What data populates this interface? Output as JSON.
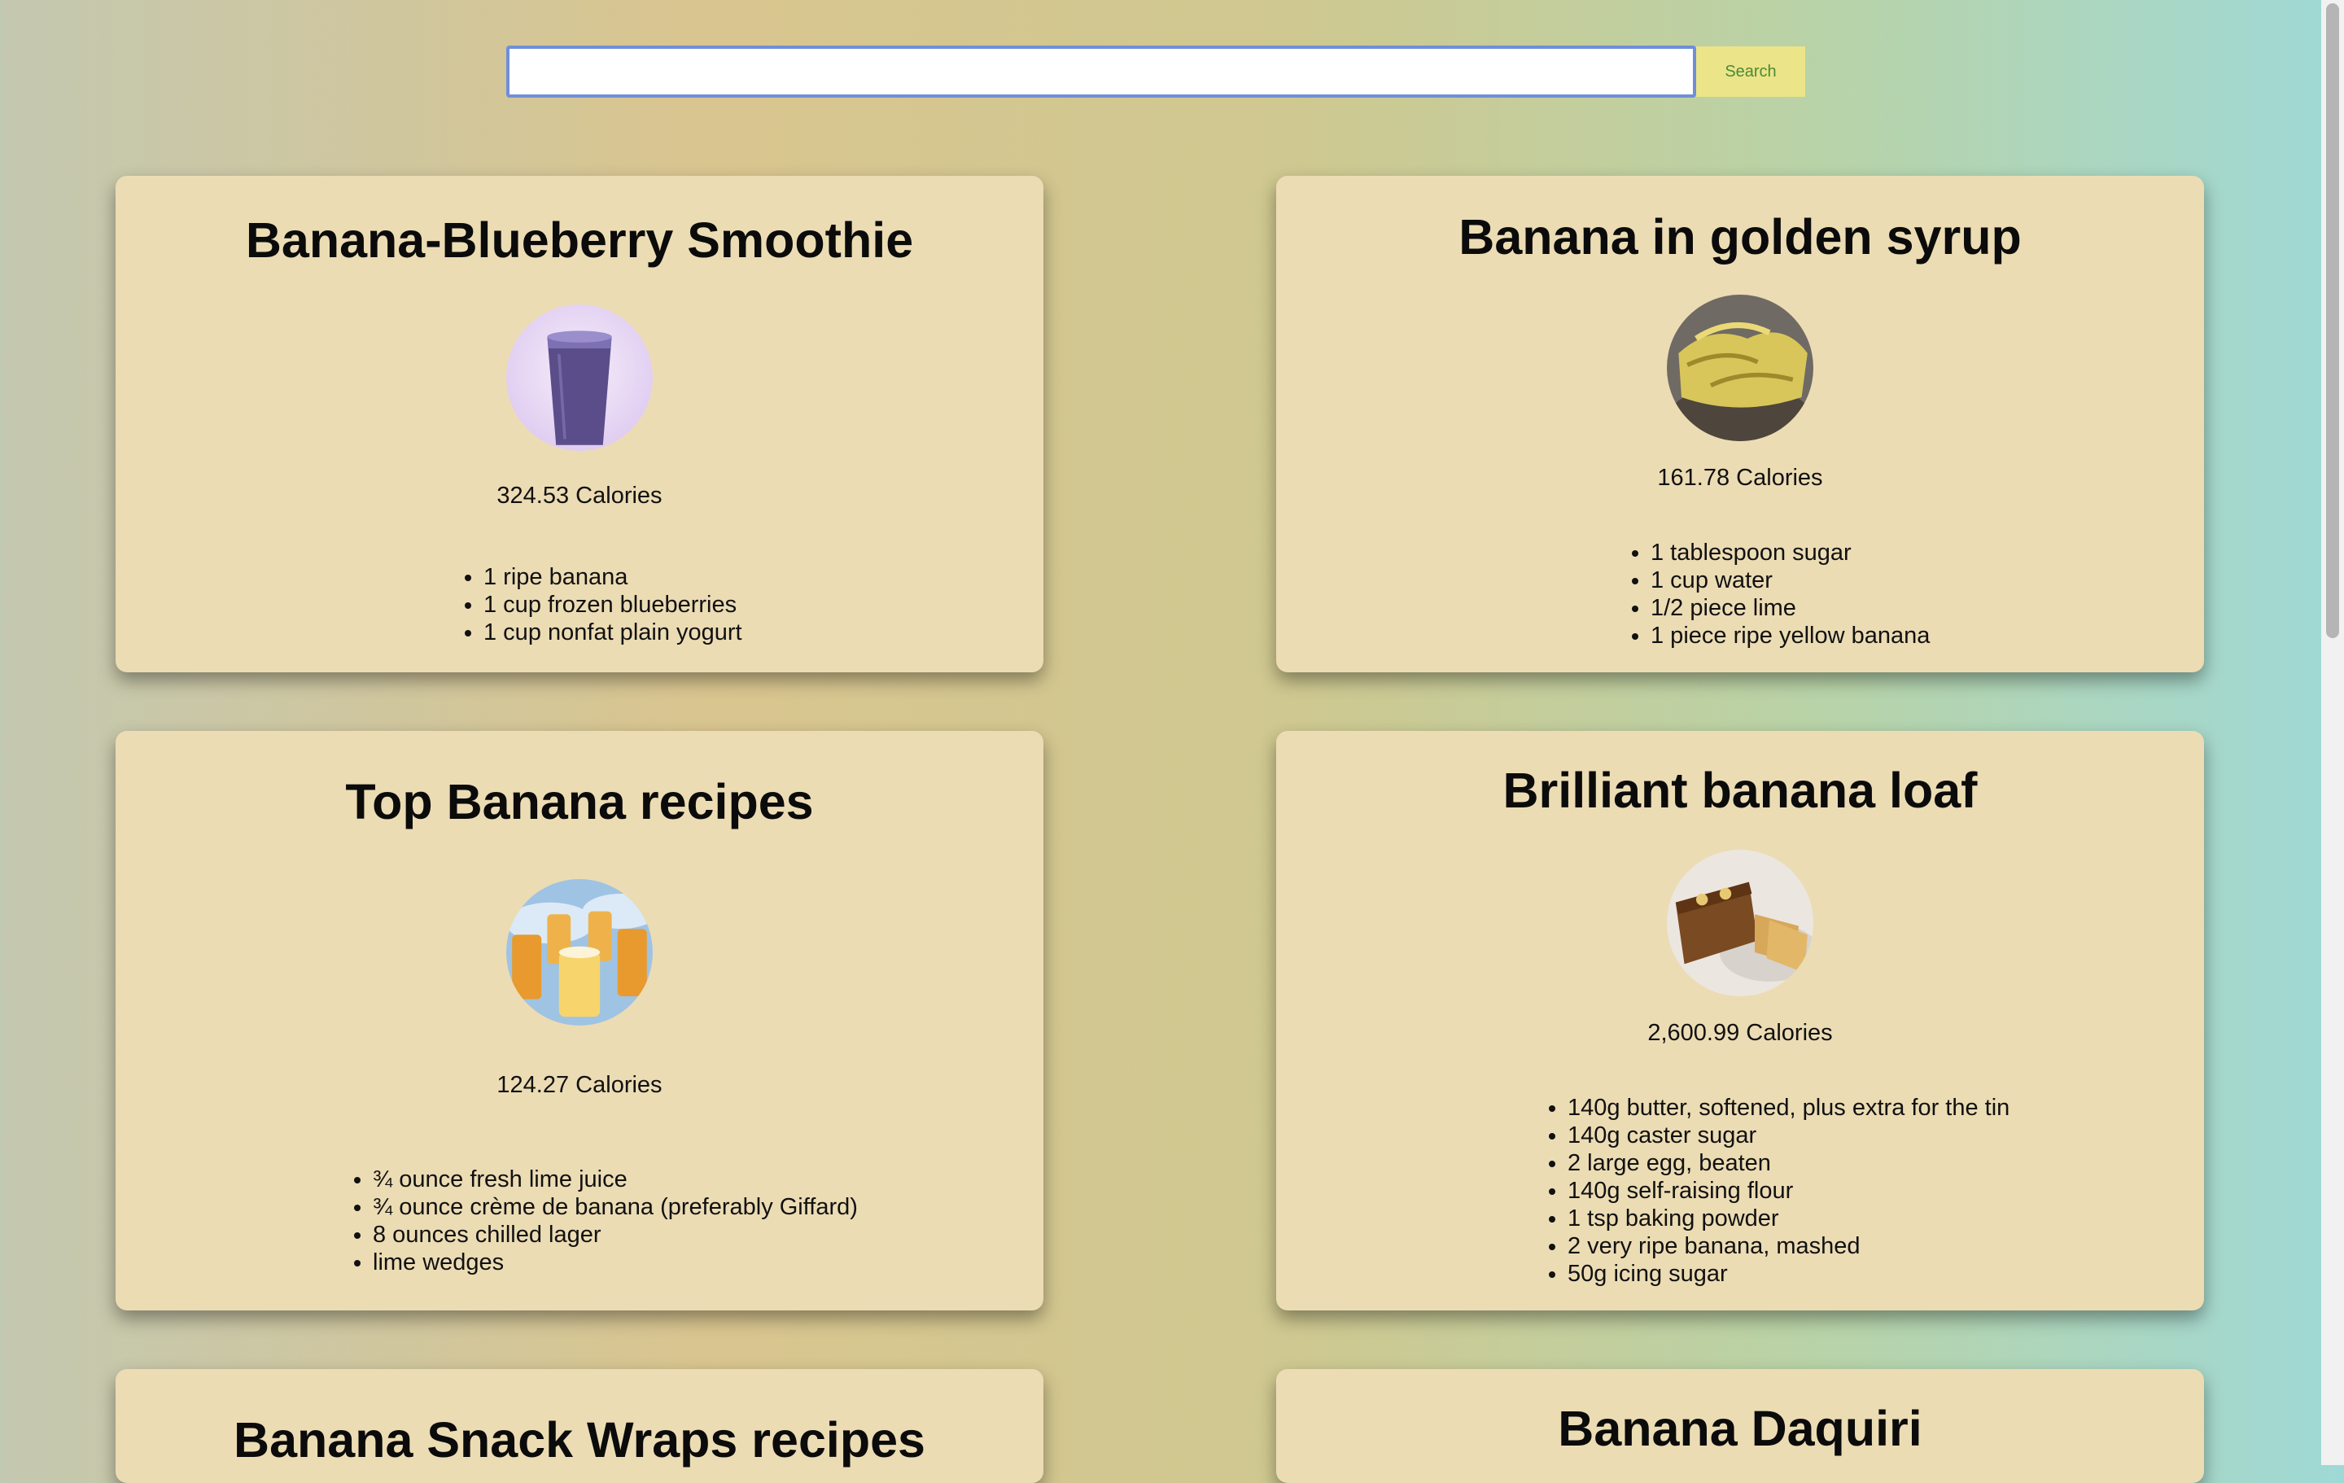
{
  "search": {
    "value": "",
    "placeholder": "",
    "button_label": "Search"
  },
  "cards": [
    {
      "title": "Banana-Blueberry Smoothie",
      "image_icon": "blueberry-smoothie-photo",
      "calories": "324.53 Calories",
      "ingredients": [
        "1 ripe banana",
        "1 cup frozen blueberries",
        "1 cup nonfat plain yogurt"
      ]
    },
    {
      "title": "Banana in golden syrup",
      "image_icon": "banana-bunch-photo",
      "calories": "161.78 Calories",
      "ingredients": [
        "1 tablespoon sugar",
        "1 cup water",
        "1/2 piece lime",
        "1 piece ripe yellow banana"
      ]
    },
    {
      "title": "Top Banana recipes",
      "image_icon": "banana-drinks-photo",
      "calories": "124.27 Calories",
      "ingredients": [
        "¾ ounce fresh lime juice",
        "¾ ounce crème de banana (preferably Giffard)",
        "8 ounces chilled lager",
        "lime wedges"
      ]
    },
    {
      "title": "Brilliant banana loaf",
      "image_icon": "banana-loaf-photo",
      "calories": "2,600.99 Calories",
      "ingredients": [
        "140g butter, softened, plus extra for the tin",
        "140g caster sugar",
        "2 large egg, beaten",
        "140g self-raising flour",
        "1 tsp baking powder",
        "2 very ripe banana, mashed",
        "50g icing sugar"
      ]
    },
    {
      "title": "Banana Snack Wraps recipes"
    },
    {
      "title": "Banana Daquiri"
    }
  ]
}
